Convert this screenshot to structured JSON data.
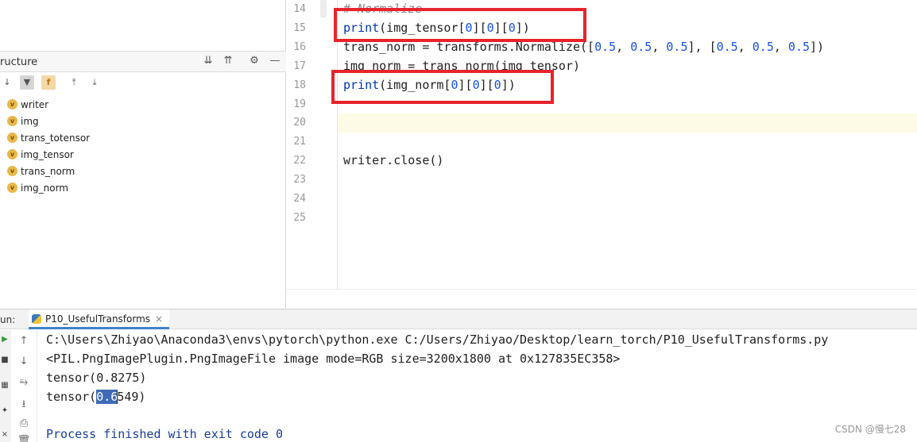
{
  "structure": {
    "title": "ructure",
    "items": [
      {
        "badge": "v",
        "label": "writer"
      },
      {
        "badge": "v",
        "label": "img"
      },
      {
        "badge": "v",
        "label": "trans_totensor"
      },
      {
        "badge": "v",
        "label": "img_tensor"
      },
      {
        "badge": "v",
        "label": "trans_norm"
      },
      {
        "badge": "v",
        "label": "img_norm"
      }
    ]
  },
  "editor": {
    "lines": [
      {
        "num": "14",
        "text": "# Normalize"
      },
      {
        "num": "15",
        "text": "print(img_tensor[0][0][0])"
      },
      {
        "num": "16",
        "text": "trans_norm = transforms.Normalize([0.5, 0.5, 0.5], [0.5, 0.5, 0.5])"
      },
      {
        "num": "17",
        "text": "img_norm = trans_norm(img_tensor)"
      },
      {
        "num": "18",
        "text": "print(img_norm[0][0][0])"
      },
      {
        "num": "19",
        "text": ""
      },
      {
        "num": "20",
        "text": ""
      },
      {
        "num": "21",
        "text": ""
      },
      {
        "num": "22",
        "text": "writer.close()"
      },
      {
        "num": "23",
        "text": ""
      },
      {
        "num": "24",
        "text": ""
      },
      {
        "num": "25",
        "text": ""
      }
    ]
  },
  "run": {
    "label": "un:",
    "tab": "P10_UsefulTransforms",
    "console": {
      "cmd": "C:\\Users\\Zhiyao\\Anaconda3\\envs\\pytorch\\python.exe C:/Users/Zhiyao/Desktop/learn_torch/P10_UsefulTransforms.py",
      "pil": "<PIL.PngImagePlugin.PngImageFile image mode=RGB size=3200x1800 at 0x127835EC358>",
      "out1": "tensor(0.8275)",
      "out2_prefix": "tensor(",
      "out2_selected": "0.6",
      "out2_suffix": "549)",
      "exit": "Process finished with exit code 0"
    }
  },
  "watermark": "CSDN @慢七28",
  "colors": {
    "highlight_box": "#e8232b",
    "selection": "#3f6bb5",
    "current_line": "#fdfbe6"
  }
}
